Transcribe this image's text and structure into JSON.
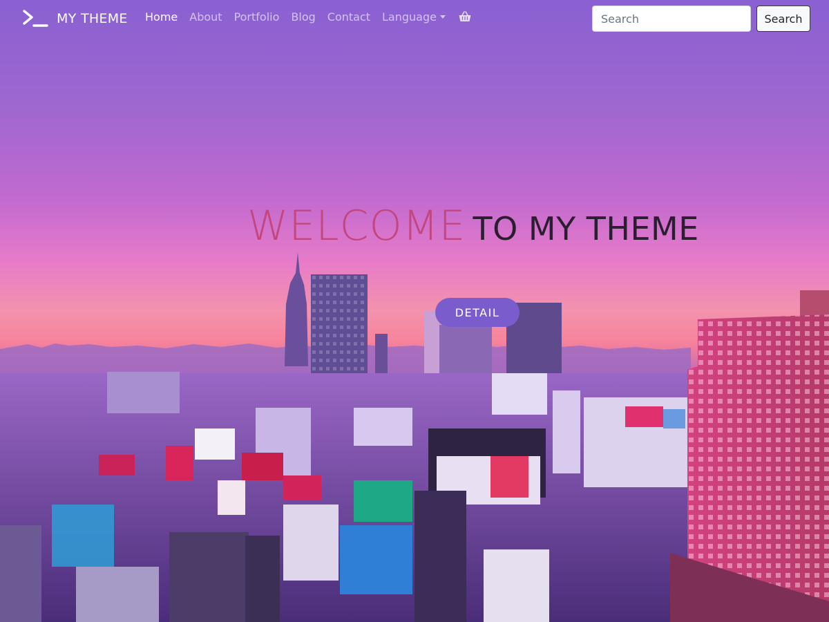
{
  "navbar": {
    "brand": "MY THEME",
    "links": [
      {
        "label": "Home",
        "active": true
      },
      {
        "label": "About"
      },
      {
        "label": "Portfolio"
      },
      {
        "label": "Blog"
      },
      {
        "label": "Contact"
      }
    ],
    "language_label": "Language",
    "search": {
      "placeholder": "Search",
      "value": "",
      "button_label": "Search"
    }
  },
  "hero": {
    "title_highlight": "WELCOME",
    "title_rest": "TO MY THEME",
    "button_label": "DETAIL"
  },
  "icons": {
    "brand": "terminal-prompt-icon",
    "dropdown": "caret-down-icon",
    "cart": "shopping-basket-icon"
  },
  "colors": {
    "title_highlight": "#c3477f",
    "title_rest": "#2a1e30",
    "button": "#7a5ccc",
    "sky_top": "#8a60d2",
    "sky_horizon": "#f392ad"
  }
}
